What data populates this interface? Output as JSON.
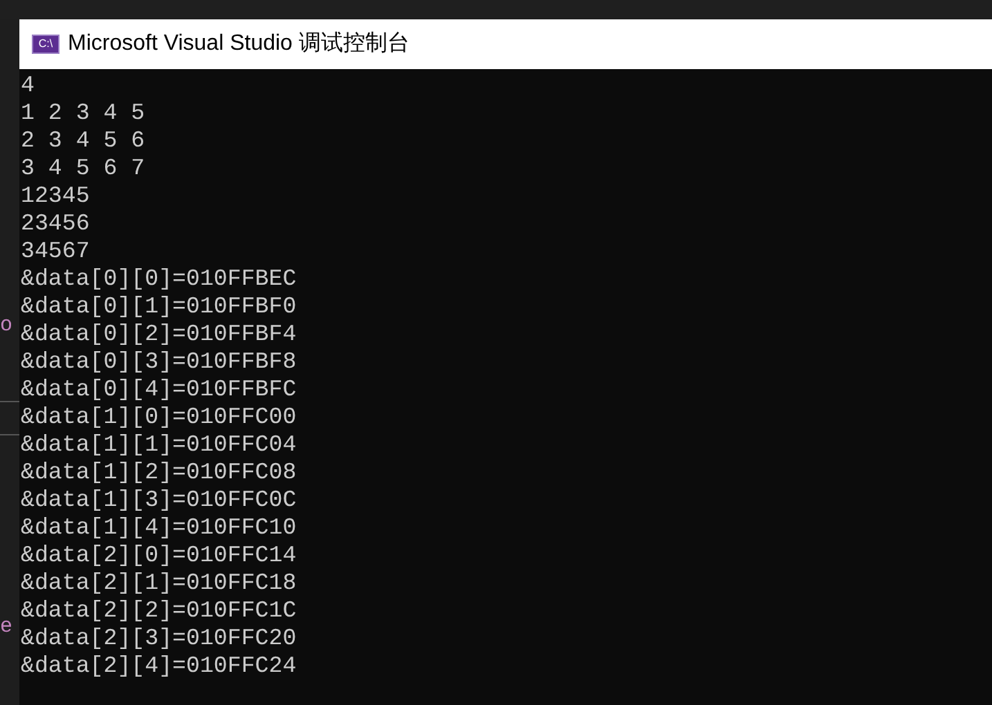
{
  "window": {
    "title": "Microsoft Visual Studio 调试控制台",
    "icon_text": "C:\\"
  },
  "background_fragments": [
    {
      "text": "o"
    },
    {
      "text": "e"
    }
  ],
  "console_lines": [
    "4",
    "1 2 3 4 5",
    "2 3 4 5 6",
    "3 4 5 6 7",
    "12345",
    "23456",
    "34567",
    "&data[0][0]=010FFBEC",
    "&data[0][1]=010FFBF0",
    "&data[0][2]=010FFBF4",
    "&data[0][3]=010FFBF8",
    "&data[0][4]=010FFBFC",
    "&data[1][0]=010FFC00",
    "&data[1][1]=010FFC04",
    "&data[1][2]=010FFC08",
    "&data[1][3]=010FFC0C",
    "&data[1][4]=010FFC10",
    "&data[2][0]=010FFC14",
    "&data[2][1]=010FFC18",
    "&data[2][2]=010FFC1C",
    "&data[2][3]=010FFC20",
    "&data[2][4]=010FFC24"
  ]
}
